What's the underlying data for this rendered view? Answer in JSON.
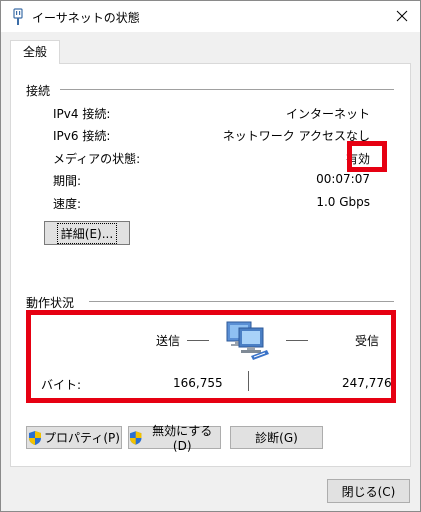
{
  "window": {
    "title": "イーサネットの状態"
  },
  "tabs": [
    {
      "label": "全般"
    }
  ],
  "connection": {
    "heading": "接続",
    "rows": [
      {
        "label": "IPv4 接続:",
        "value": "インターネット"
      },
      {
        "label": "IPv6 接続:",
        "value": "ネットワーク アクセスなし"
      },
      {
        "label": "メディアの状態:",
        "value": "有効"
      },
      {
        "label": "期間:",
        "value": "00:07:07"
      },
      {
        "label": "速度:",
        "value": "1.0 Gbps"
      }
    ],
    "details_button": "詳細(E)..."
  },
  "activity": {
    "heading": "動作状況",
    "sent_label": "送信",
    "received_label": "受信",
    "bytes_label": "バイト:",
    "bytes_sent": "166,755",
    "bytes_received": "247,776"
  },
  "buttons": {
    "properties": "プロパティ(P)",
    "disable": "無効にする(D)",
    "diagnose": "診断(G)",
    "close": "閉じる(C)"
  },
  "icons": {
    "title": "network-adapter-icon",
    "activity": "network-computers-icon",
    "shield": "uac-shield-icon"
  },
  "colors": {
    "highlight": "#e60012",
    "shield_blue": "#2a6fd1",
    "shield_yellow": "#f2c200"
  }
}
